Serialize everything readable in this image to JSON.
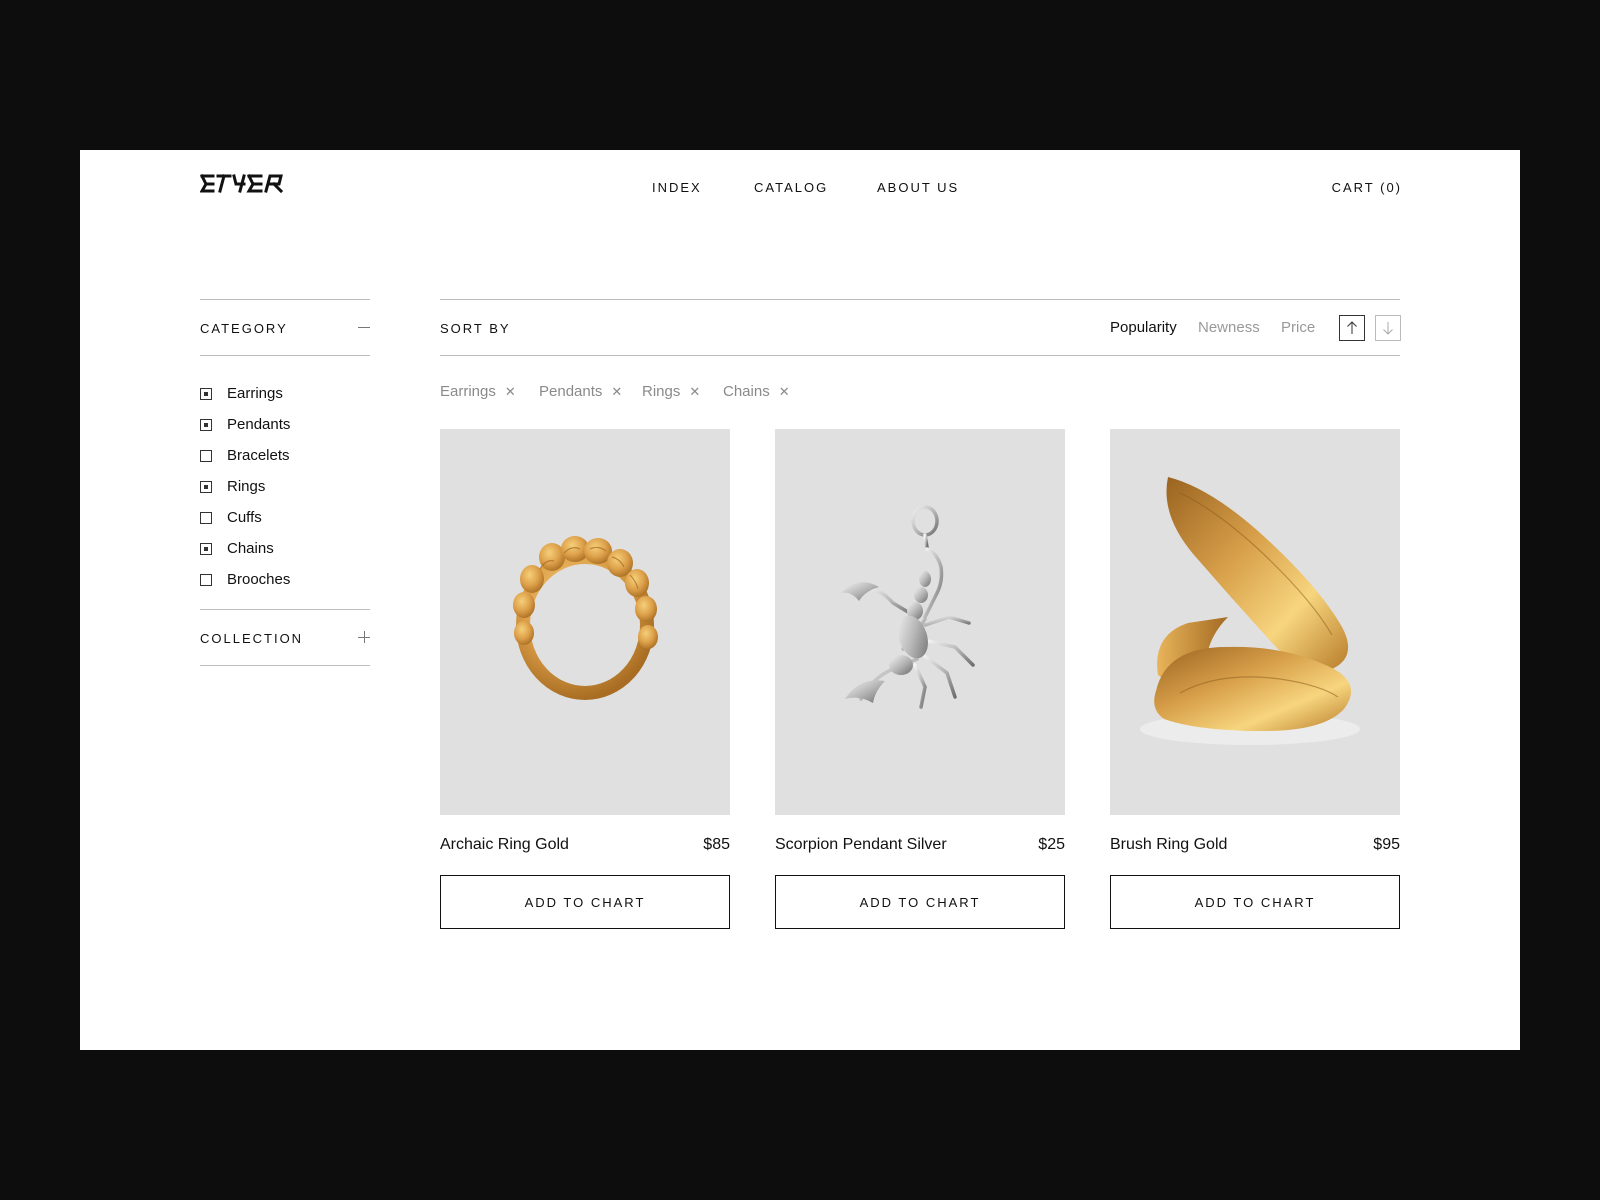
{
  "header": {
    "logo_text": "ETHER",
    "nav": [
      "INDEX",
      "CATALOG",
      "ABOUT US"
    ],
    "cart_label": "CART (0)"
  },
  "sidebar": {
    "category": {
      "title": "CATEGORY",
      "expanded": true,
      "items": [
        {
          "label": "Earrings",
          "checked": true
        },
        {
          "label": "Pendants",
          "checked": true
        },
        {
          "label": "Bracelets",
          "checked": false
        },
        {
          "label": "Rings",
          "checked": true
        },
        {
          "label": "Cuffs",
          "checked": false
        },
        {
          "label": "Chains",
          "checked": true
        },
        {
          "label": "Brooches",
          "checked": false
        }
      ]
    },
    "collection": {
      "title": "COLLECTION",
      "expanded": false
    }
  },
  "sort": {
    "title": "SORT BY",
    "options": [
      "Popularity",
      "Newness",
      "Price"
    ],
    "active": "Popularity",
    "direction_icons": [
      "arrow-up-icon",
      "arrow-down-icon"
    ],
    "active_direction": "up"
  },
  "active_filters": [
    "Earrings",
    "Pendants",
    "Rings",
    "Chains"
  ],
  "products": [
    {
      "name": "Archaic Ring Gold",
      "price": "$85",
      "button": "ADD TO CHART",
      "image": "gold-twisted-ring"
    },
    {
      "name": "Scorpion Pendant Silver",
      "price": "$25",
      "button": "ADD TO CHART",
      "image": "silver-scorpion-pendant"
    },
    {
      "name": "Brush Ring Gold",
      "price": "$95",
      "button": "ADD TO CHART",
      "image": "gold-brush-ring"
    }
  ],
  "colors": {
    "frame": "#0d0d0d",
    "page": "#ffffff",
    "image_bg": "#e0e0e0",
    "muted_text": "#8a8a8a",
    "gold": "#d8a24a",
    "silver": "#c8c8c8"
  }
}
